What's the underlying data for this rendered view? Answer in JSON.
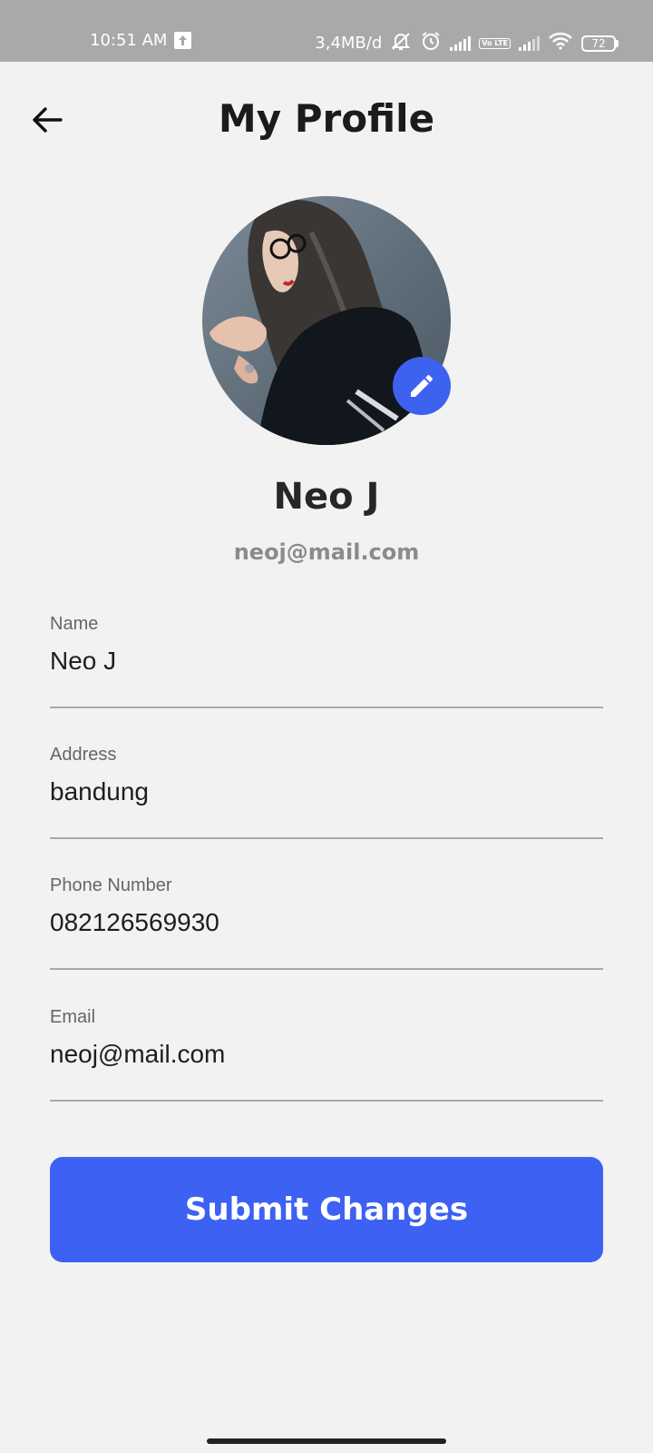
{
  "status_bar": {
    "time": "10:51 AM",
    "network_speed": "3,4MB/d",
    "battery": "72",
    "volte": "Vo LTE",
    "icons": [
      "upload-icon",
      "mute-icon",
      "alarm-icon",
      "signal-icon",
      "volte-icon",
      "signal-icon",
      "wifi-icon",
      "battery-icon"
    ]
  },
  "header": {
    "title": "My Profile",
    "back_icon": "arrow-left-icon"
  },
  "profile": {
    "name": "Neo J",
    "email": "neoj@mail.com",
    "edit_icon": "pencil-icon"
  },
  "form": {
    "fields": [
      {
        "label": "Name",
        "value": "Neo J"
      },
      {
        "label": "Address",
        "value": "bandung"
      },
      {
        "label": "Phone Number",
        "value": "082126569930"
      },
      {
        "label": "Email",
        "value": "neoj@mail.com"
      }
    ],
    "submit_label": "Submit Changes"
  },
  "colors": {
    "accent": "#3c61f3",
    "background": "#f2f2f2",
    "status_bar": "#a9a9a9"
  }
}
